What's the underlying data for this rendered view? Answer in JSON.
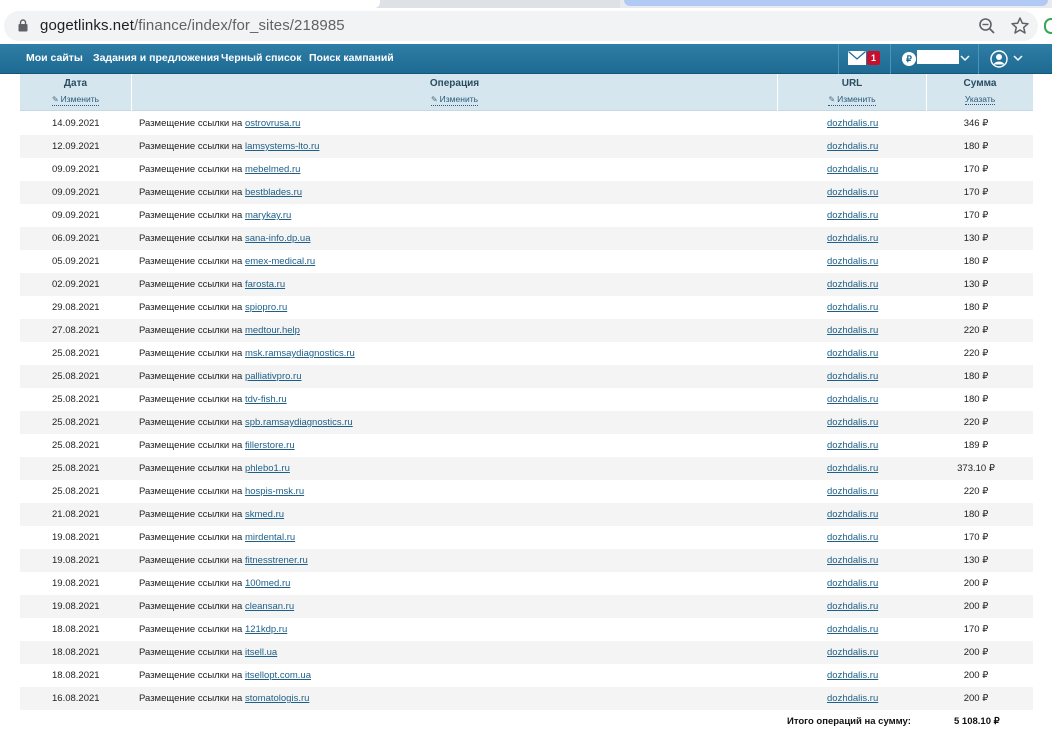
{
  "browser": {
    "url_host": "gogetlinks.net",
    "url_path": "/finance/index/for_sites/218985"
  },
  "nav": {
    "items": [
      "Мои сайты",
      "Задания и предложения",
      "Черный список",
      "Поиск кампаний"
    ],
    "mail_badge": "1",
    "currency_symbol": "₽"
  },
  "table": {
    "headers": [
      {
        "title": "Дата",
        "link": "Изменить"
      },
      {
        "title": "Операция",
        "link": "Изменить"
      },
      {
        "title": "URL",
        "link": "Изменить"
      },
      {
        "title": "Сумма",
        "link": "Указать"
      }
    ],
    "op_prefix": "Размещение ссылки на",
    "rows": [
      {
        "date": "14.09.2021",
        "site": "ostrovrusa.ru",
        "url": "dozhdalis.ru",
        "sum": "346 ₽"
      },
      {
        "date": "12.09.2021",
        "site": "lamsystems-lto.ru",
        "url": "dozhdalis.ru",
        "sum": "180 ₽"
      },
      {
        "date": "09.09.2021",
        "site": "mebelmed.ru",
        "url": "dozhdalis.ru",
        "sum": "170 ₽"
      },
      {
        "date": "09.09.2021",
        "site": "bestblades.ru",
        "url": "dozhdalis.ru",
        "sum": "170 ₽"
      },
      {
        "date": "09.09.2021",
        "site": "marykay.ru",
        "url": "dozhdalis.ru",
        "sum": "170 ₽"
      },
      {
        "date": "06.09.2021",
        "site": "sana-info.dp.ua",
        "url": "dozhdalis.ru",
        "sum": "130 ₽"
      },
      {
        "date": "05.09.2021",
        "site": "emex-medical.ru",
        "url": "dozhdalis.ru",
        "sum": "180 ₽"
      },
      {
        "date": "02.09.2021",
        "site": "farosta.ru",
        "url": "dozhdalis.ru",
        "sum": "130 ₽"
      },
      {
        "date": "29.08.2021",
        "site": "spiopro.ru",
        "url": "dozhdalis.ru",
        "sum": "180 ₽"
      },
      {
        "date": "27.08.2021",
        "site": "medtour.help",
        "url": "dozhdalis.ru",
        "sum": "220 ₽"
      },
      {
        "date": "25.08.2021",
        "site": "msk.ramsaydiagnostics.ru",
        "url": "dozhdalis.ru",
        "sum": "220 ₽"
      },
      {
        "date": "25.08.2021",
        "site": "palliativpro.ru",
        "url": "dozhdalis.ru",
        "sum": "180 ₽"
      },
      {
        "date": "25.08.2021",
        "site": "tdv-fish.ru",
        "url": "dozhdalis.ru",
        "sum": "180 ₽"
      },
      {
        "date": "25.08.2021",
        "site": "spb.ramsaydiagnostics.ru",
        "url": "dozhdalis.ru",
        "sum": "220 ₽"
      },
      {
        "date": "25.08.2021",
        "site": "fillerstore.ru",
        "url": "dozhdalis.ru",
        "sum": "189 ₽"
      },
      {
        "date": "25.08.2021",
        "site": "phlebo1.ru",
        "url": "dozhdalis.ru",
        "sum": "373.10 ₽"
      },
      {
        "date": "25.08.2021",
        "site": "hospis-msk.ru",
        "url": "dozhdalis.ru",
        "sum": "220 ₽"
      },
      {
        "date": "21.08.2021",
        "site": "skmed.ru",
        "url": "dozhdalis.ru",
        "sum": "180 ₽"
      },
      {
        "date": "19.08.2021",
        "site": "mirdental.ru",
        "url": "dozhdalis.ru",
        "sum": "170 ₽"
      },
      {
        "date": "19.08.2021",
        "site": "fitnesstrener.ru",
        "url": "dozhdalis.ru",
        "sum": "130 ₽"
      },
      {
        "date": "19.08.2021",
        "site": "100med.ru",
        "url": "dozhdalis.ru",
        "sum": "200 ₽"
      },
      {
        "date": "19.08.2021",
        "site": "cleansan.ru",
        "url": "dozhdalis.ru",
        "sum": "200 ₽"
      },
      {
        "date": "18.08.2021",
        "site": "121kdp.ru",
        "url": "dozhdalis.ru",
        "sum": "170 ₽"
      },
      {
        "date": "18.08.2021",
        "site": "itsell.ua",
        "url": "dozhdalis.ru",
        "sum": "200 ₽"
      },
      {
        "date": "18.08.2021",
        "site": "itsellopt.com.ua",
        "url": "dozhdalis.ru",
        "sum": "200 ₽"
      },
      {
        "date": "16.08.2021",
        "site": "stomatologis.ru",
        "url": "dozhdalis.ru",
        "sum": "200 ₽"
      }
    ]
  },
  "footer": {
    "total_label": "Итого операций на сумму:",
    "total_value": "5 108.10 ₽"
  }
}
